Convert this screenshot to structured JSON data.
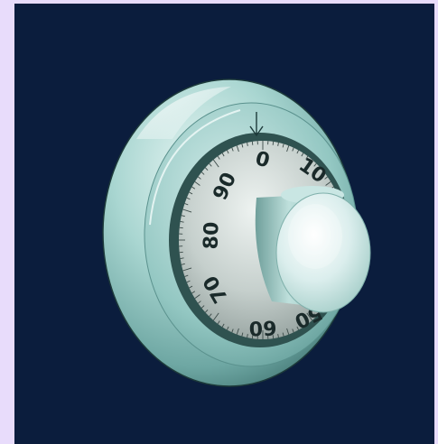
{
  "scene": {
    "subject": "safe-combination-dial",
    "colors": {
      "page_background": "#e8dcfb",
      "panel_background": "#0b1d3d",
      "metal_light": "#d8eeec",
      "metal_mid": "#9ecfca",
      "metal_dark": "#5e9a97",
      "numbers": "#1a2a2a"
    }
  },
  "dial": {
    "indicator": "index-arrow",
    "numbers": [
      "0",
      "10",
      "90",
      "80",
      "70",
      "60",
      "50"
    ]
  }
}
